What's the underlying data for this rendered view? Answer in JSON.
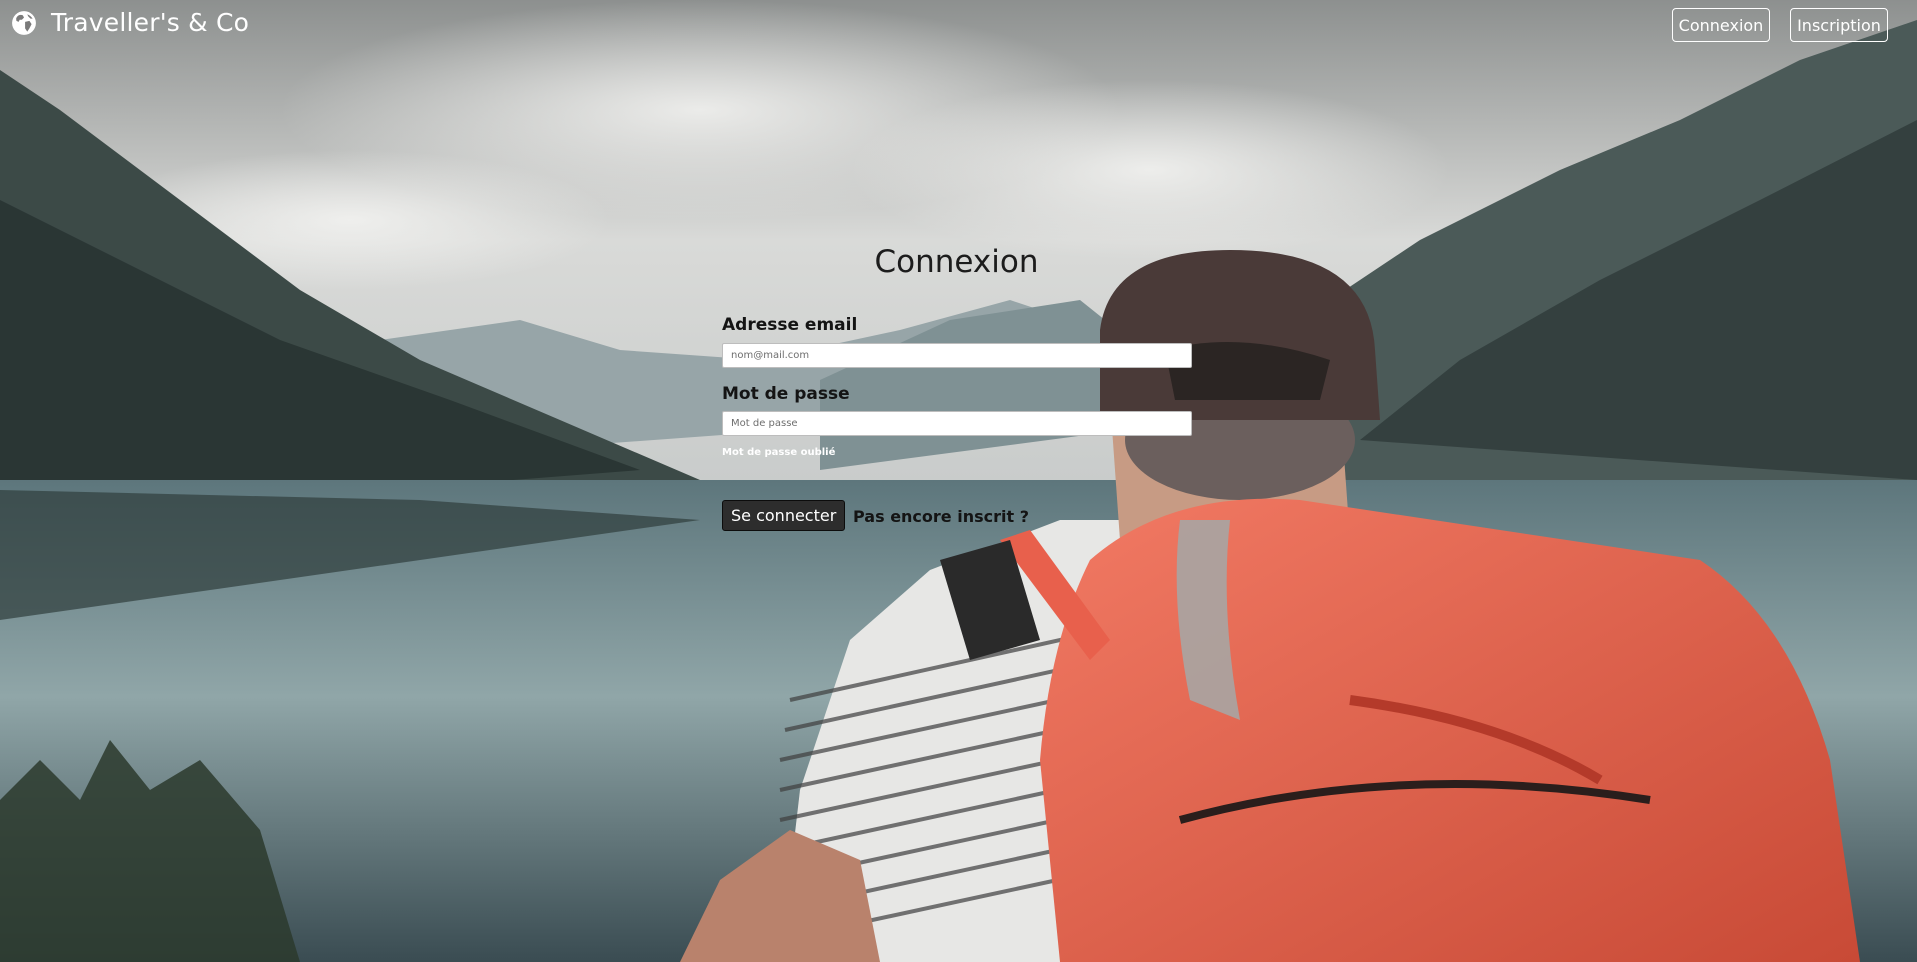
{
  "header": {
    "brand_name": "Traveller's & Co",
    "brand_icon": "globe-icon",
    "login_label": "Connexion",
    "register_label": "Inscription"
  },
  "form": {
    "title": "Connexion",
    "email_label": "Adresse email",
    "email_placeholder": "nom@mail.com",
    "email_value": "",
    "password_label": "Mot de passe",
    "password_placeholder": "Mot de passe",
    "password_value": "",
    "forgot_label": "Mot de passe oublié",
    "submit_label": "Se connecter",
    "register_prompt": "Pas encore inscrit ?"
  },
  "colors": {
    "button_bg": "#2d2d2d",
    "text_dark": "#141414",
    "backpack": "#e8604c",
    "lake": "#6f8c92"
  }
}
